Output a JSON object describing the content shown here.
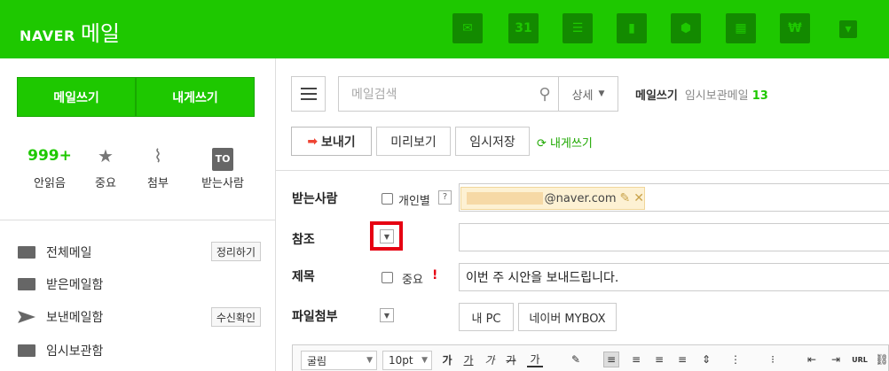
{
  "header": {
    "brand": "NAVER",
    "product": "메일",
    "icons": [
      "mail-icon",
      "calendar-icon",
      "list-icon",
      "contacts-icon",
      "cube-icon",
      "note-icon",
      "home-pay-icon",
      "more-icon"
    ],
    "calendar_day": "31",
    "pay_symbol": "₩"
  },
  "sidebar": {
    "write_label": "메일쓰기",
    "self_label": "내게쓰기",
    "quick": [
      {
        "value": "999+",
        "label": "안읽음"
      },
      {
        "icon": "star-icon",
        "label": "중요"
      },
      {
        "icon": "paperclip-icon",
        "label": "첨부"
      },
      {
        "badge": "TO",
        "label": "받는사람"
      }
    ],
    "folders": [
      {
        "label": "전체메일",
        "action": "정리하기"
      },
      {
        "label": "받은메일함"
      },
      {
        "label": "보낸메일함",
        "action": "수신확인"
      },
      {
        "label": "임시보관함"
      }
    ]
  },
  "toolbar": {
    "search_placeholder": "메일검색",
    "detail_label": "상세",
    "breadcrumb_current": "메일쓰기",
    "breadcrumb_sub": "임시보관메일",
    "draft_count": "13",
    "send": "보내기",
    "preview": "미리보기",
    "save_draft": "임시저장",
    "self_mail": "내게쓰기"
  },
  "compose": {
    "to_label": "받는사람",
    "individual_label": "개인별",
    "help": "?",
    "recipient_domain": "@naver.com",
    "cc_label": "참조",
    "subject_label": "제목",
    "important_label": "중요",
    "important_mark": "!",
    "subject_value": "이번 주 시안을 보내드립니다.",
    "attach_label": "파일첨부",
    "my_pc": "내 PC",
    "mybox": "네이버 MYBOX"
  },
  "editor": {
    "font": "굴림",
    "size": "10pt",
    "bold": "가",
    "underline": "가",
    "italic": "가",
    "strike": "가",
    "color": "가",
    "url": "URL"
  }
}
